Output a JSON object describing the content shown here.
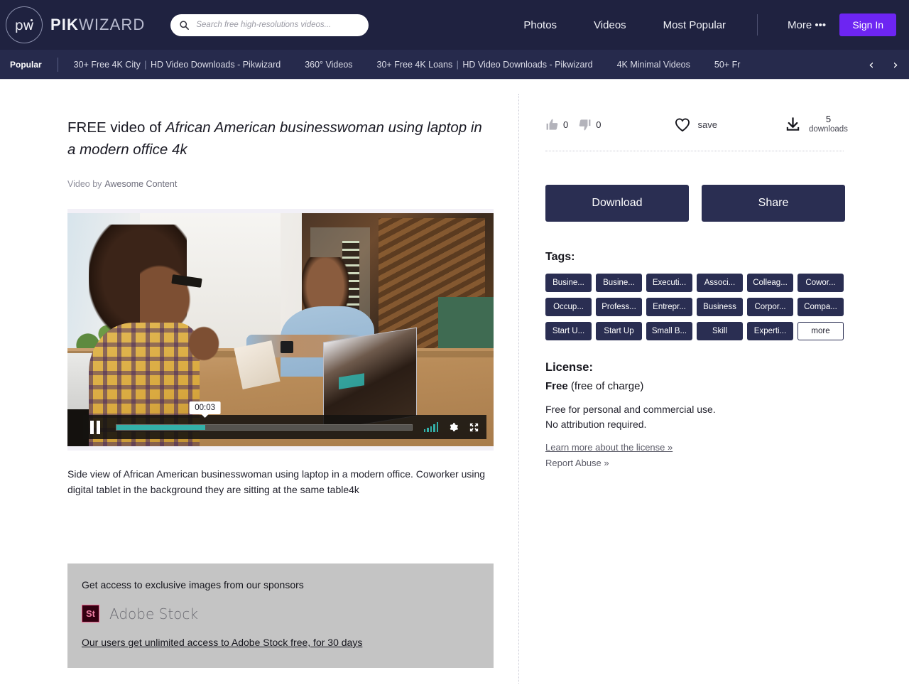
{
  "header": {
    "logo_mark": "pw",
    "logo_text_bold": "PIK",
    "logo_text_light": "WIZARD",
    "search_placeholder": "Search free high-resolutions videos...",
    "search_value": "",
    "nav": [
      {
        "label": "Photos"
      },
      {
        "label": "Videos"
      },
      {
        "label": "Most Popular"
      }
    ],
    "more_label": "More •••",
    "signin_label": "Sign In"
  },
  "subnav": {
    "popular_label": "Popular",
    "items": [
      {
        "label": "30+ Free 4K City",
        "suffix": "HD Video Downloads - Pikwizard"
      },
      {
        "label": "360° Videos",
        "suffix": ""
      },
      {
        "label": "30+ Free 4K Loans",
        "suffix": "HD Video Downloads - Pikwizard"
      },
      {
        "label": "4K Minimal Videos",
        "suffix": ""
      },
      {
        "label": "50+ Fr",
        "suffix": ""
      }
    ],
    "prev_icon": "‹",
    "next_icon": "›"
  },
  "main": {
    "title_prefix": "FREE video of ",
    "title_subject": "African American businesswoman using laptop in a modern office 4k",
    "byline_label": "Video by",
    "byline_author": "Awesome Content",
    "description": "Side view of African American businesswoman using laptop in a modern office. Coworker using digital tablet in the background they are sitting at the same table4k"
  },
  "player": {
    "state": "paused",
    "current_time": "00:03",
    "progress_percent": 30
  },
  "sponsor": {
    "heading": "Get access to exclusive images from our sponsors",
    "badge": "St",
    "brand": "Adobe Stock",
    "link": "Our users get unlimited access to Adobe Stock free, for 30 days"
  },
  "sidebar": {
    "likes": "0",
    "dislikes": "0",
    "save_label": "save",
    "downloads_count": "5",
    "downloads_label": "downloads",
    "download_label": "Download",
    "share_label": "Share",
    "tags_title": "Tags:",
    "tags": [
      "Busine...",
      "Busine...",
      "Executi...",
      "Associ...",
      "Colleag...",
      "Cowor...",
      "Occup...",
      "Profess...",
      "Entrepr...",
      "Business",
      "Corpor...",
      "Compa...",
      "Start U...",
      "Start Up",
      "Small B...",
      "Skill",
      "Experti...",
      "more"
    ],
    "license_title": "License:",
    "license_value": "Free",
    "license_note": "(free of charge)",
    "license_text_1": "Free for personal and commercial use.",
    "license_text_2": "No attribution required.",
    "learn_more_link": "Learn more about the license »",
    "report_abuse_link": "Report Abuse »"
  },
  "colors": {
    "header_bg": "#1f2240",
    "subnav_bg": "#262a4c",
    "accent_purple": "#6d25f2",
    "dark_navy": "#2a2e52",
    "teal": "#33b0a8",
    "sponsor_bg": "#c4c4c4"
  }
}
